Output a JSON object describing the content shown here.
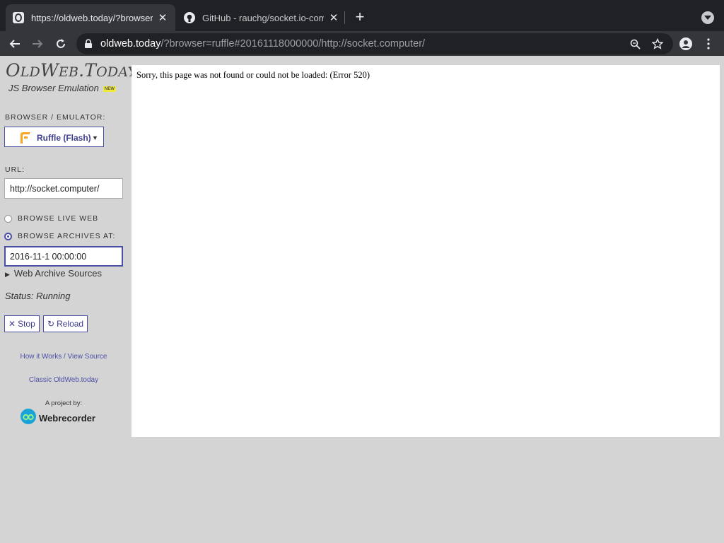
{
  "browser": {
    "tabs": [
      {
        "title": "https://oldweb.today/?browser",
        "active": true
      },
      {
        "title": "GitHub - rauchg/socket.io-com",
        "active": false
      }
    ],
    "address": {
      "host": "oldweb.today",
      "path": "/?browser=ruffle#20161118000000/http://socket.computer/"
    }
  },
  "sidebar": {
    "logo": {
      "part1": "O",
      "part2": "LD",
      "part3": "W",
      "part4": "EB",
      "part5": ".T",
      "part6": "ODAY"
    },
    "subtitle": "JS Browser Emulation",
    "new_badge": "NEW",
    "browser_label": "BROWSER / EMULATOR:",
    "browser_selected": "Ruffle (Flash)",
    "url_label": "URL:",
    "url_value": "http://socket.computer/",
    "radio_live": "BROWSE LIVE WEB",
    "radio_archives": "BROWSE ARCHIVES AT:",
    "date_value": "2016-11-1 00:00:00",
    "sources_label": "Web Archive Sources",
    "status": "Status: Running",
    "stop_label": "Stop",
    "reload_label": "Reload",
    "how_link": "How it Works / View Source",
    "classic_link": "Classic OldWeb.today",
    "project_label": "A project by:",
    "webrecorder": "Webrecorder"
  },
  "content": {
    "message": "Sorry, this page was not found or could not be loaded: (Error 520)"
  },
  "colors": {
    "accent": "#4a4fa6",
    "chrome_dark": "#202124",
    "chrome_toolbar": "#35363a"
  }
}
